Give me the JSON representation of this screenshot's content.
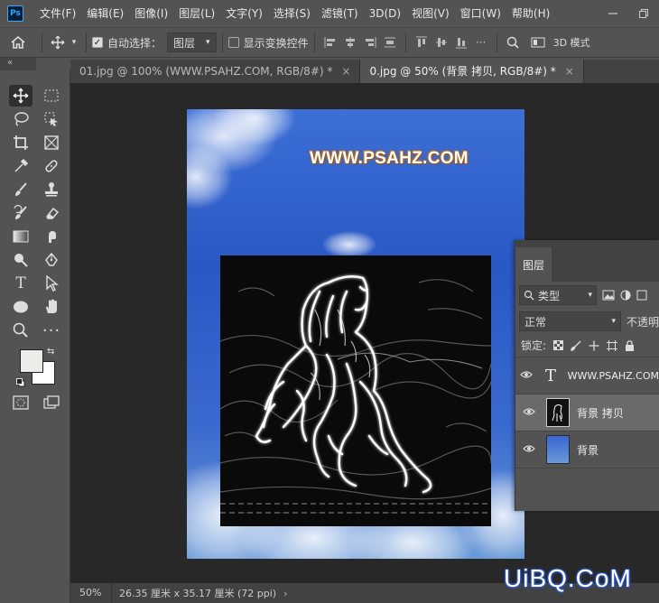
{
  "app": {
    "logo_text": "Ps"
  },
  "menu": [
    "文件(F)",
    "编辑(E)",
    "图像(I)",
    "图层(L)",
    "文字(Y)",
    "选择(S)",
    "滤镜(T)",
    "3D(D)",
    "视图(V)",
    "窗口(W)",
    "帮助(H)"
  ],
  "options": {
    "auto_select_label": "自动选择：",
    "auto_select_value": "图层",
    "show_transform_label": "显示变换控件",
    "mode_3d_label": "3D 模式"
  },
  "tabs": [
    {
      "label": "01.jpg @ 100% (WWW.PSAHZ.COM, RGB/8#) *",
      "close": "×"
    },
    {
      "label": "0.jpg @ 50% (背景 拷贝, RGB/8#) *",
      "close": "×"
    }
  ],
  "document": {
    "text_layer_content": "WWW.PSAHZ.COM"
  },
  "status": {
    "zoom": "50%",
    "doc_size": "26.35 厘米 x 35.17 厘米 (72 ppi)",
    "arrow": "›"
  },
  "layers_panel": {
    "tab_label": "图层",
    "kind_filter": "类型",
    "blend_mode": "正常",
    "opacity_label": "不透明",
    "lock_label": "锁定:",
    "layers": [
      {
        "name": "WWW.PSAHZ.COM",
        "kind": "text",
        "visible": true,
        "selected": false
      },
      {
        "name": "背景 拷贝",
        "kind": "pixel",
        "visible": true,
        "selected": true
      },
      {
        "name": "背景",
        "kind": "pixel",
        "visible": true,
        "selected": false
      }
    ]
  },
  "site_watermark": "UiBQ.CoM"
}
